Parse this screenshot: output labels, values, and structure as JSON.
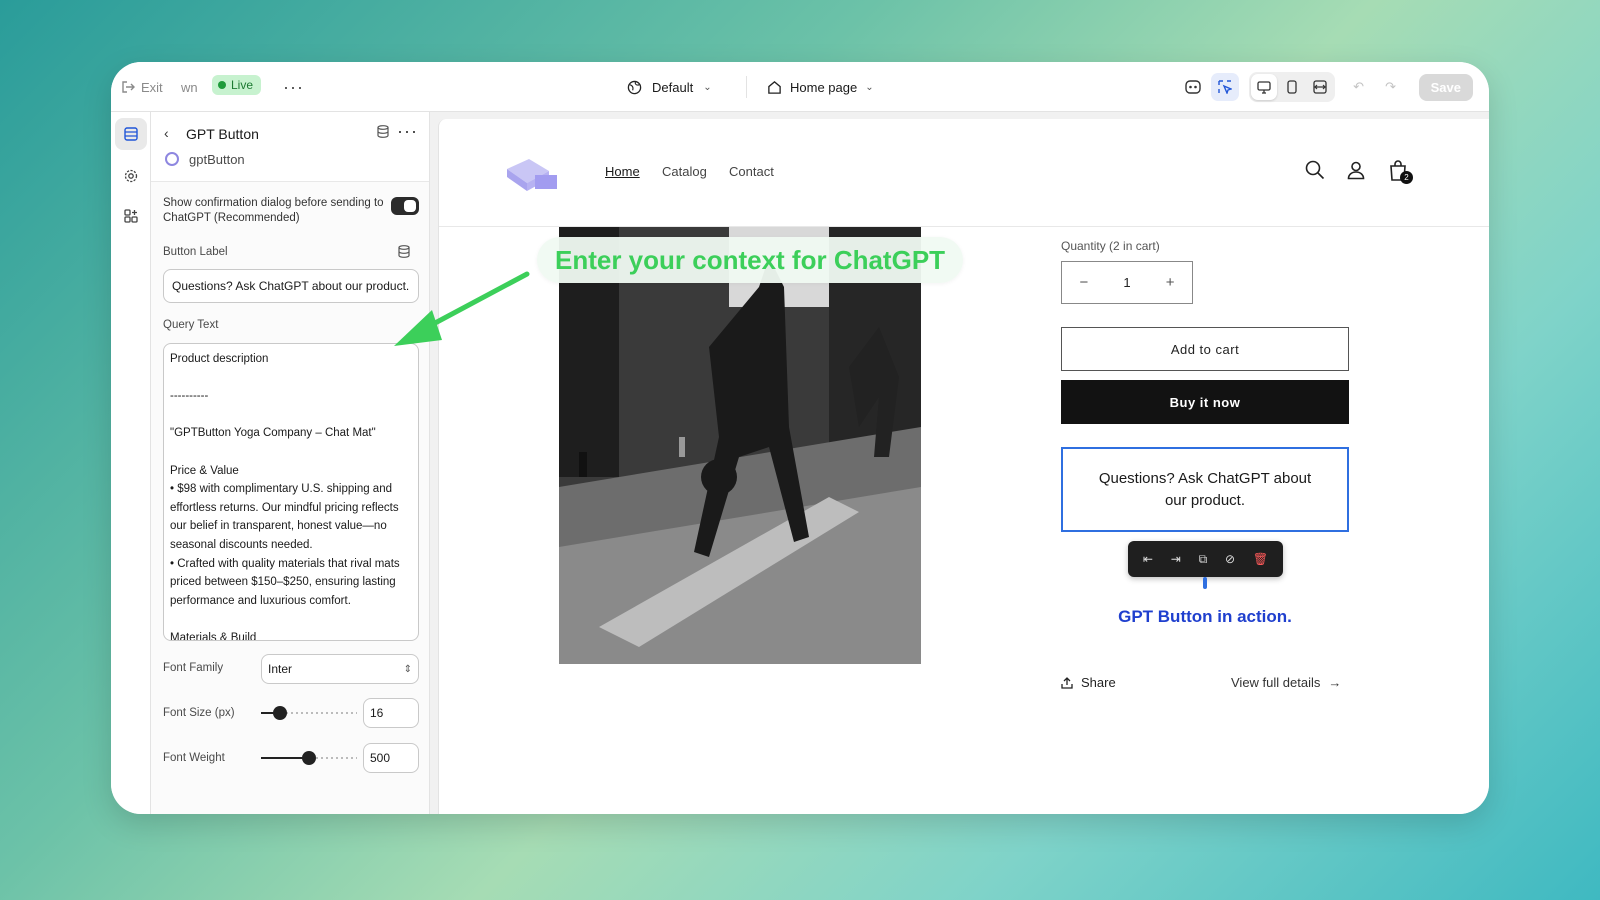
{
  "topbar": {
    "exit_label": "Exit",
    "truncated_label": "wn",
    "live_label": "Live",
    "theme_label": "Default",
    "page_label": "Home page",
    "save_label": "Save"
  },
  "panel": {
    "title": "GPT Button",
    "subtitle": "gptButton",
    "toggle_label": "Show confirmation dialog before sending to ChatGPT (Recommended)",
    "toggle_on": true,
    "button_label_title": "Button Label",
    "button_label_value": "Questions? Ask ChatGPT about our product.",
    "query_text_title": "Query Text",
    "query_text_value": "Product description\n\n----------\n\n\"GPTButton Yoga Company – Chat Mat\"\n\nPrice & Value\n• $98 with complimentary U.S. shipping and effortless returns. Our mindful pricing reflects our belief in transparent, honest value—no seasonal discounts needed.\n• Crafted with quality materials that rival mats priced between $150–$250, ensuring lasting performance and luxurious comfort.\n\nMaterials & Build",
    "font_family_title": "Font Family",
    "font_family_value": "Inter",
    "font_size_title": "Font Size (px)",
    "font_size_value": "16",
    "font_size_fraction": 0.2,
    "font_weight_title": "Font Weight",
    "font_weight_value": "500",
    "font_weight_fraction": 0.5
  },
  "store": {
    "nav": [
      "Home",
      "Catalog",
      "Contact"
    ],
    "cart_count": "2",
    "quantity_label": "Quantity (2 in cart)",
    "quantity_value": "1",
    "minus": "−",
    "plus": "+",
    "add_to_cart": "Add to cart",
    "buy_now": "Buy it now",
    "gpt_button_text": "Questions? Ask ChatGPT about our product.",
    "gpt_caption": "GPT Button in action.",
    "share_label": "Share",
    "details_label": "View full details"
  },
  "annotation": {
    "callout": "Enter your context for ChatGPT",
    "color": "#3ccf5a"
  },
  "colors": {
    "accent_blue": "#2f6fe0",
    "live_green": "#1f9b3a",
    "caption_blue": "#1f3fce"
  }
}
